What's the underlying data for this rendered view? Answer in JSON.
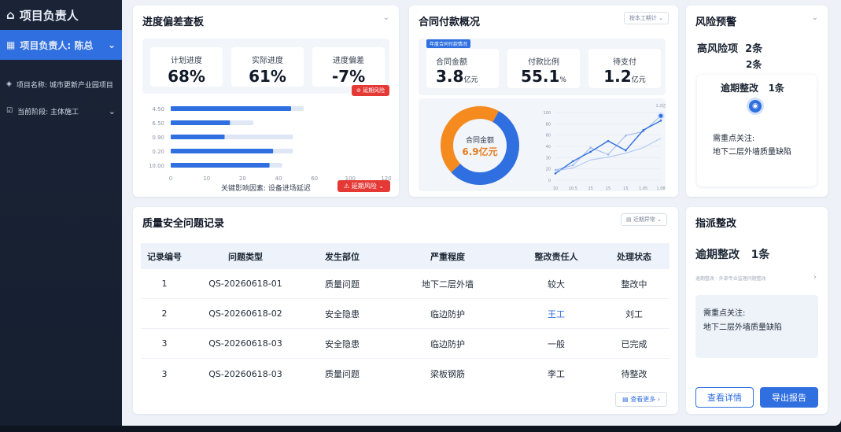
{
  "sidebar": {
    "title": "项目负责人",
    "active": "项目负责人: 陈总",
    "items": [
      {
        "label": "项目名称: 城市更新产业园项目"
      },
      {
        "label": "当前阶段: 主体施工"
      }
    ]
  },
  "progress": {
    "title": "进度偏差查板",
    "metrics": [
      {
        "label": "计划进度",
        "value": "68%"
      },
      {
        "label": "实际进度",
        "value": "61%"
      },
      {
        "label": "进度偏差",
        "value": "-7%"
      }
    ],
    "risk_badge": "延期风险",
    "key_factor": "关键影响因素: 设备进场延迟",
    "risk_button": "延期风险"
  },
  "contract": {
    "title": "合同付款概况",
    "filter": "按本工期计",
    "tag": "年度合同付款情况",
    "metrics": [
      {
        "label": "合同金额",
        "value": "3.8",
        "unit": "亿元"
      },
      {
        "label": "付款比例",
        "value": "55.1",
        "unit": "%"
      },
      {
        "label": "待支付",
        "value": "1.2",
        "unit": "亿元"
      }
    ],
    "donut_label": "合同金额",
    "donut_value": "6.9亿元"
  },
  "risk": {
    "title": "风险预警",
    "high_label": "高风险项",
    "high_value": "2条",
    "high_value2": "2条",
    "overdue_label": "逾期整改",
    "overdue_value": "1条",
    "focus_label": "需重点关注:",
    "focus_text": "地下二层外墙质量缺陷"
  },
  "quality": {
    "title": "质量安全问题记录",
    "filter": "近期异常",
    "headers": [
      "记录编号",
      "问题类型",
      "发生部位",
      "严重程度",
      "整改责任人",
      "处理状态"
    ],
    "rows": [
      [
        "1",
        "QS-20260618-01",
        "质量问题",
        "地下二层外墙",
        "较大",
        "整改中"
      ],
      [
        "2",
        "QS-20260618-02",
        "安全隐患",
        "临边防护",
        "王工",
        "刘工"
      ],
      [
        "3",
        "QS-20260618-03",
        "安全隐患",
        "临边防护",
        "一般",
        "已完成"
      ],
      [
        "3",
        "QS-20260618-03",
        "质量问题",
        "梁板钢筋",
        "李工",
        "待整改"
      ]
    ],
    "more": "查看更多"
  },
  "assign": {
    "title": "指派整改",
    "overdue_label": "逾期整改",
    "overdue_value": "1条",
    "sub": "逾期整改 · 外部专业监理问题整改",
    "focus_label": "需重点关注:",
    "focus_text": "地下二层外墙质量缺陷",
    "btn_detail": "查看详情",
    "btn_export": "导出报告"
  },
  "chart_data": [
    {
      "type": "bar",
      "categories": [
        "4.50",
        "6.50",
        "0.90",
        "0.20",
        "10.00"
      ],
      "series": [
        {
          "values": [
            67,
            33,
            30,
            57,
            55
          ]
        },
        {
          "values": [
            74,
            46,
            68,
            68,
            62
          ]
        }
      ],
      "xticks": [
        "0",
        "10",
        "20",
        "40",
        "60",
        "100",
        "120"
      ],
      "xlim": [
        0,
        120
      ]
    },
    {
      "type": "pie",
      "values": [
        55.1,
        44.9
      ],
      "colors": [
        "#2f6fe0",
        "#f58a1f"
      ]
    },
    {
      "type": "line",
      "x": [
        "10",
        "10.5",
        "15",
        "15",
        "15",
        "1.05",
        "1.08"
      ],
      "yticks": [
        "100",
        "80",
        "60",
        "40",
        "30",
        "20",
        "0"
      ],
      "series": [
        {
          "values": [
            15,
            22,
            48,
            38,
            66,
            72,
            95
          ]
        },
        {
          "values": [
            10,
            28,
            42,
            58,
            44,
            74,
            88
          ]
        },
        {
          "values": [
            14,
            18,
            30,
            34,
            40,
            48,
            62
          ]
        }
      ],
      "end_label": "1.2亿"
    }
  ]
}
